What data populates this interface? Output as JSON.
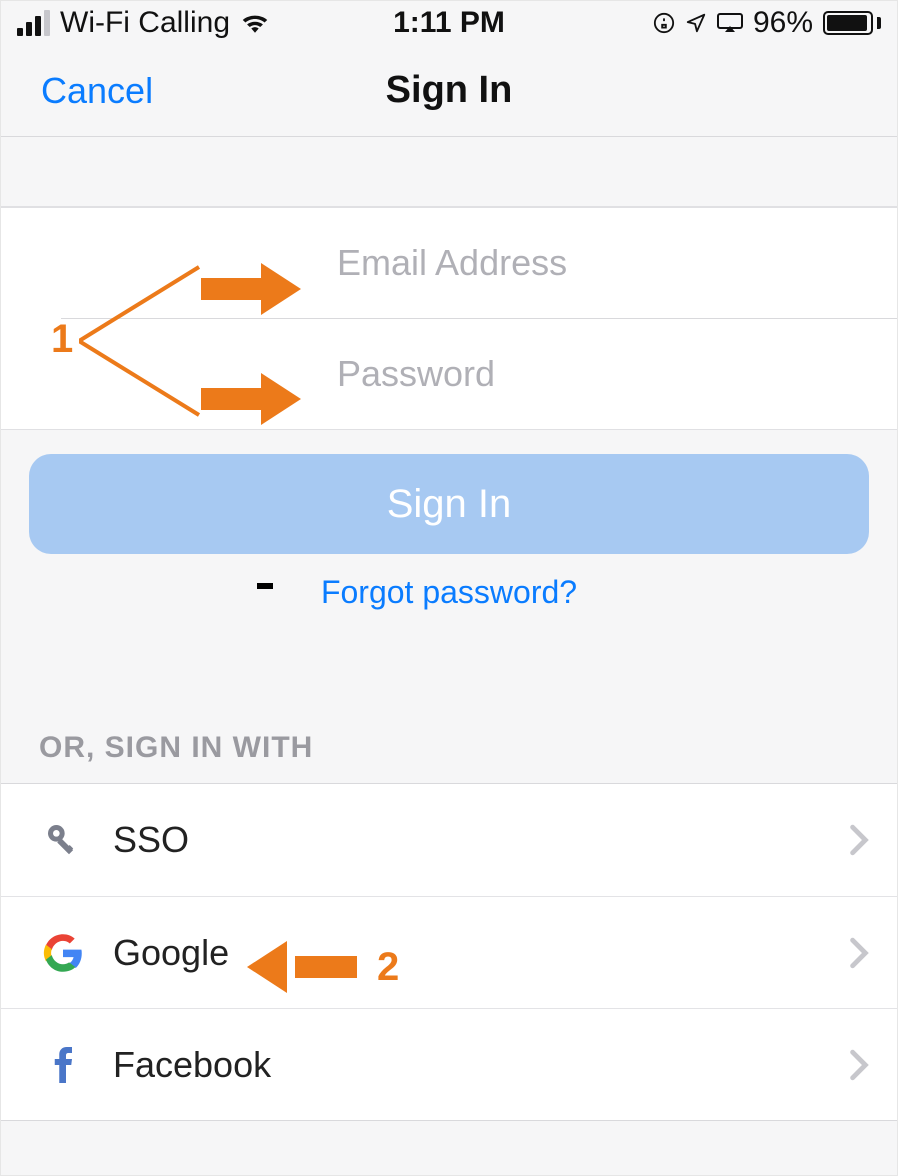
{
  "status": {
    "carrier": "Wi-Fi Calling",
    "time": "1:11 PM",
    "battery_pct": "96%"
  },
  "nav": {
    "cancel": "Cancel",
    "title": "Sign In"
  },
  "form": {
    "email_placeholder": "Email Address",
    "password_placeholder": "Password",
    "signin_button": "Sign In",
    "forgot": "Forgot password?"
  },
  "or_header": "OR, SIGN IN WITH",
  "providers": [
    {
      "label": "SSO"
    },
    {
      "label": "Google"
    },
    {
      "label": "Facebook"
    }
  ],
  "annotations": {
    "one": "1",
    "two": "2"
  }
}
